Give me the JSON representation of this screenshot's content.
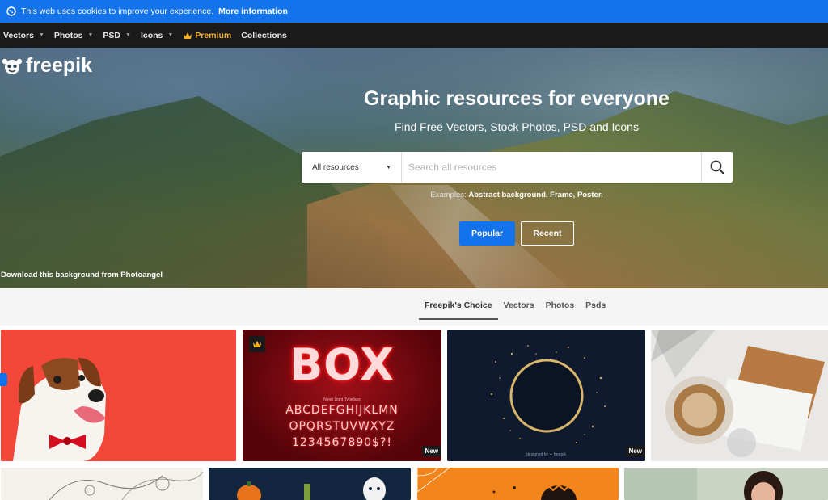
{
  "cookie_bar": {
    "text": "This web uses cookies to improve your experience.",
    "link": "More information"
  },
  "nav": {
    "items": [
      {
        "label": "Vectors"
      },
      {
        "label": "Photos"
      },
      {
        "label": "PSD"
      },
      {
        "label": "Icons"
      }
    ],
    "premium": "Premium",
    "collections": "Collections"
  },
  "logo": {
    "text": "freepik"
  },
  "hero": {
    "title": "Graphic resources for everyone",
    "subtitle": "Find Free Vectors, Stock Photos, PSD and Icons",
    "search": {
      "filter": "All resources",
      "placeholder": "Search all resources"
    },
    "examples_label": "Examples:",
    "examples": "Abstract background, Frame, Poster.",
    "popular_button": "Popular",
    "recent_button": "Recent",
    "credit": "Download this background from Photoangel"
  },
  "tabs": [
    {
      "label": "Freepik's Choice",
      "active": true
    },
    {
      "label": "Vectors"
    },
    {
      "label": "Photos"
    },
    {
      "label": "Psds"
    }
  ],
  "cards": {
    "box": {
      "title": "BOX",
      "caption": "Neon Light Typeface",
      "row1": "ABCDEFGHIJKLMN",
      "row2": "OPQRSTUVWXYZ",
      "row3": "1234567890$?!",
      "badge": "New"
    },
    "ring": {
      "caption": "designed by ✦ freepik",
      "badge": "New"
    }
  },
  "colors": {
    "brand_blue": "#1273eb",
    "nav_bg": "#1a1a1a",
    "premium": "#f6b026"
  }
}
